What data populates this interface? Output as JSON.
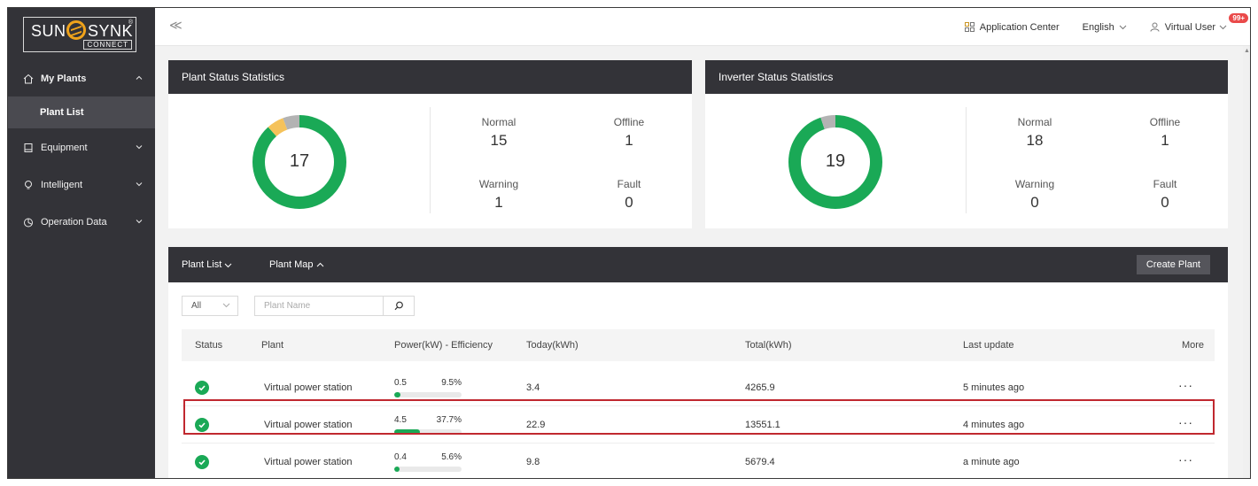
{
  "brand": {
    "word_left": "SUN",
    "word_right": "SYNK",
    "tm": "®",
    "sub": "CONNECT"
  },
  "sidebar": {
    "items": [
      {
        "label": "My Plants",
        "icon": "home-icon",
        "open": true,
        "subitems": [
          {
            "label": "Plant List"
          }
        ]
      },
      {
        "label": "Equipment",
        "icon": "device-icon"
      },
      {
        "label": "Intelligent",
        "icon": "bulb-icon"
      },
      {
        "label": "Operation Data",
        "icon": "chart-icon"
      }
    ]
  },
  "header": {
    "collapse_glyph": "≪",
    "app_center": "Application Center",
    "language": "English",
    "user": "Virtual User",
    "badge": "99+"
  },
  "plant_stats": {
    "title": "Plant Status Statistics",
    "total": "17",
    "normal_label": "Normal",
    "normal": "15",
    "offline_label": "Offline",
    "offline": "1",
    "warning_label": "Warning",
    "warning": "1",
    "fault_label": "Fault",
    "fault": "0",
    "colors": {
      "normal": "#1aa956",
      "warning": "#f5c25a",
      "offline": "#b3b3b3"
    }
  },
  "inverter_stats": {
    "title": "Inverter Status Statistics",
    "total": "19",
    "normal_label": "Normal",
    "normal": "18",
    "offline_label": "Offline",
    "offline": "1",
    "warning_label": "Warning",
    "warning": "0",
    "fault_label": "Fault",
    "fault": "0"
  },
  "plant_list": {
    "tab_list": "Plant List",
    "tab_map": "Plant Map",
    "create_button": "Create Plant",
    "filter_value": "All",
    "search_placeholder": "Plant Name",
    "columns": [
      "Status",
      "Plant",
      "Power(kW) - Efficiency",
      "Today(kWh)",
      "Total(kWh)",
      "Last update",
      "More"
    ],
    "rows": [
      {
        "plant": "Virtual power station",
        "power": "0.5",
        "efficiency": "9.5%",
        "eff_value": 9.5,
        "today": "3.4",
        "total": "4265.9",
        "updated": "5 minutes ago",
        "more": "···"
      },
      {
        "plant": "Virtual power station",
        "power": "4.5",
        "efficiency": "37.7%",
        "eff_value": 37.7,
        "today": "22.9",
        "total": "13551.1",
        "updated": "4 minutes ago",
        "more": "···"
      },
      {
        "plant": "Virtual power station",
        "power": "0.4",
        "efficiency": "5.6%",
        "eff_value": 5.6,
        "today": "9.8",
        "total": "5679.4",
        "updated": "a minute ago",
        "more": "···"
      }
    ]
  }
}
